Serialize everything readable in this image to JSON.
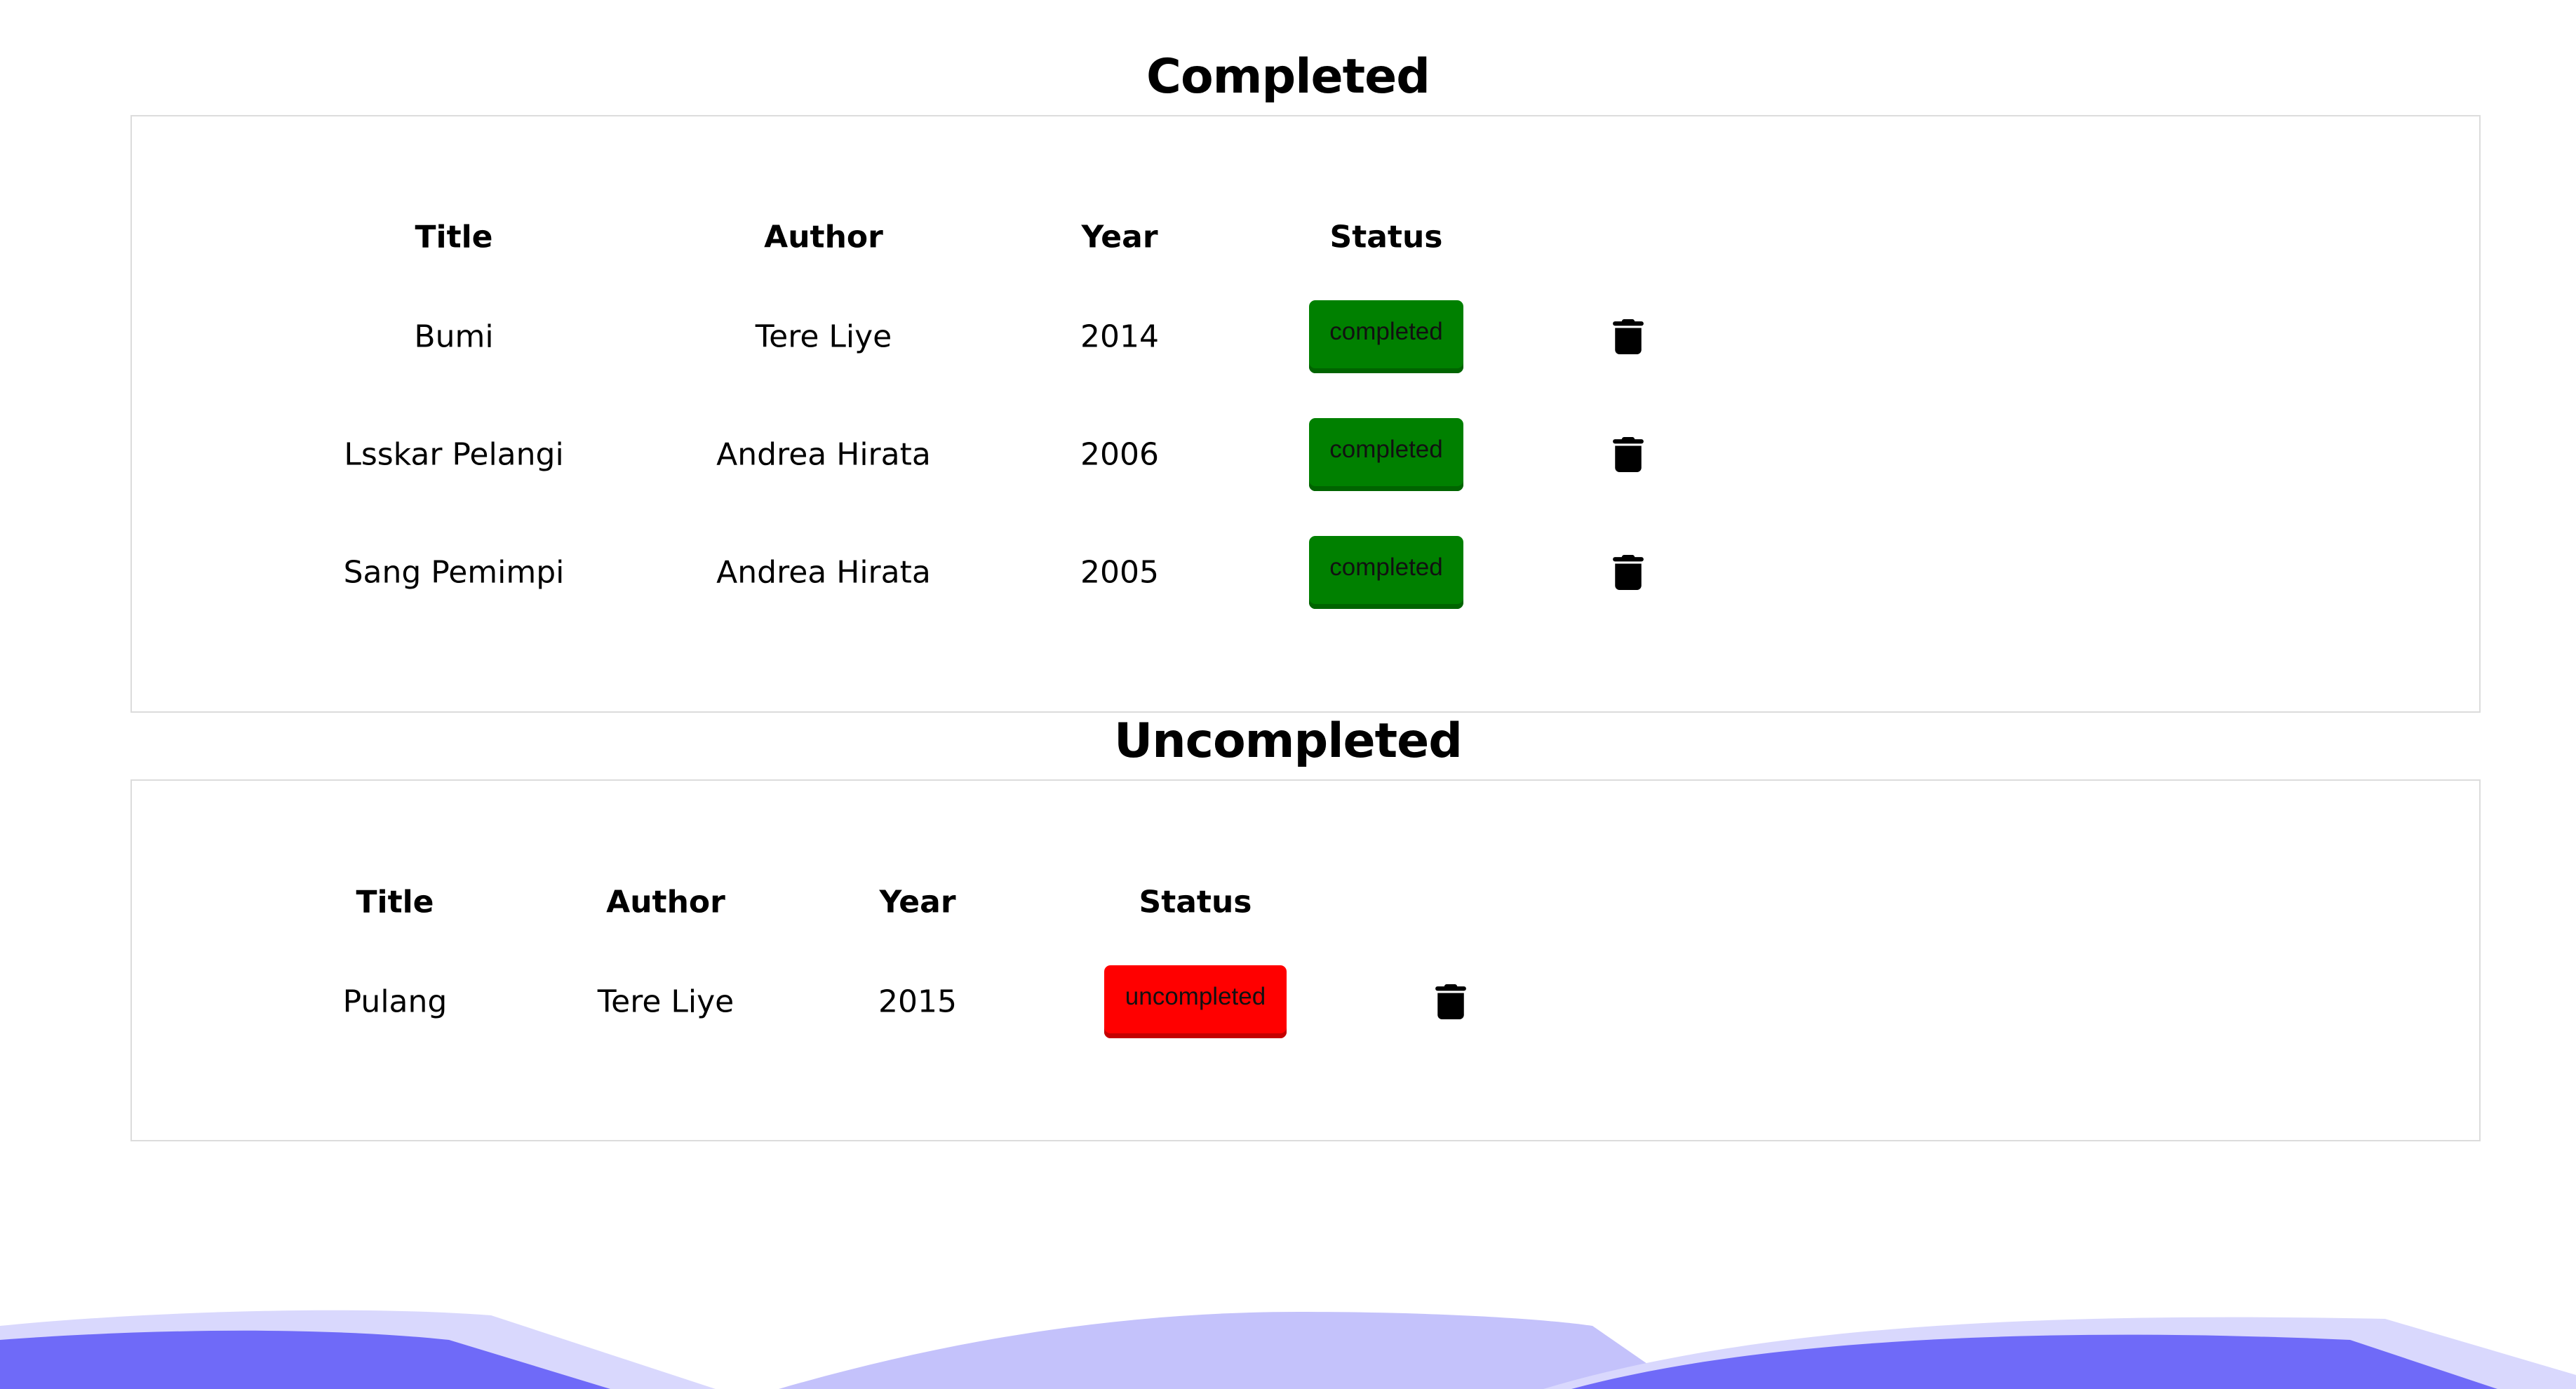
{
  "completed": {
    "heading": "Completed",
    "headers": {
      "title": "Title",
      "author": "Author",
      "year": "Year",
      "status": "Status"
    },
    "rows": [
      {
        "title": "Bumi",
        "author": "Tere Liye",
        "year": "2014",
        "status": "completed"
      },
      {
        "title": "Lsskar Pelangi",
        "author": "Andrea Hirata",
        "year": "2006",
        "status": "completed"
      },
      {
        "title": "Sang Pemimpi",
        "author": "Andrea Hirata",
        "year": "2005",
        "status": "completed"
      }
    ]
  },
  "uncompleted": {
    "heading": "Uncompleted",
    "headers": {
      "title": "Title",
      "author": "Author",
      "year": "Year",
      "status": "Status"
    },
    "rows": [
      {
        "title": "Pulang",
        "author": "Tere Liye",
        "year": "2015",
        "status": "uncompleted"
      }
    ]
  },
  "colors": {
    "completed_status": "#008000",
    "uncompleted_status": "#ff0000",
    "wave_dark": "#6f6af8",
    "wave_light": "#c4c2fb"
  },
  "icons": {
    "delete": "trash-icon"
  }
}
